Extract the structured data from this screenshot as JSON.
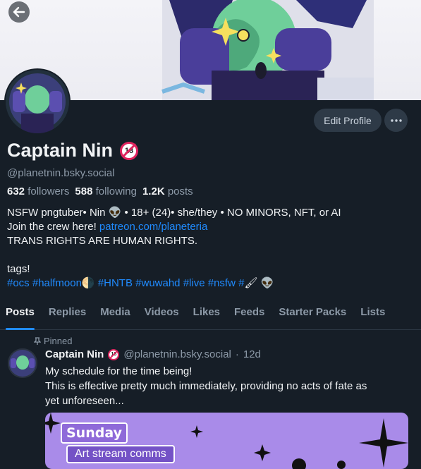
{
  "header": {
    "back_label": "Back"
  },
  "profile": {
    "display_name": "Captain Nin",
    "handle": "@planetnin.bsky.social",
    "adult_badge": "18",
    "edit_label": "Edit Profile",
    "more_label": "···",
    "stats": {
      "followers_count": "632",
      "followers_label": "followers",
      "following_count": "588",
      "following_label": "following",
      "posts_count": "1.2K",
      "posts_label": "posts"
    },
    "bio": {
      "line1": "NSFW pngtuber• Nin 👽 • 18+ (24)• she/they • NO MINORS, NFT, or AI",
      "line2_prefix": "Join the crew here! ",
      "line2_link": "patreon.com/planeteria",
      "line3": "TRANS RIGHTS ARE HUMAN RIGHTS.",
      "line5": "tags!",
      "tags": [
        "#ocs",
        "#halfmoon",
        "🌗",
        "#HNTB",
        "#wuwahd",
        "#live",
        "#nsfw",
        "#",
        "🖌",
        "👽"
      ]
    }
  },
  "tabs": [
    "Posts",
    "Replies",
    "Media",
    "Videos",
    "Likes",
    "Feeds",
    "Starter Packs",
    "Lists"
  ],
  "pinned_post": {
    "pinned_label": "Pinned",
    "author": "Captain Nin",
    "handle": "@planetnin.bsky.social",
    "separator": "·",
    "age": "12d",
    "text_line1": "My schedule for the time being!",
    "text_line2": "This is effective pretty much immediately, providing no acts of fate as",
    "text_line3": "yet unforeseen...",
    "image": {
      "day": "Sunday",
      "line": "Art stream comms"
    }
  },
  "colors": {
    "accent": "#208bfe",
    "background": "#161e27",
    "badge": "#e0245e"
  }
}
